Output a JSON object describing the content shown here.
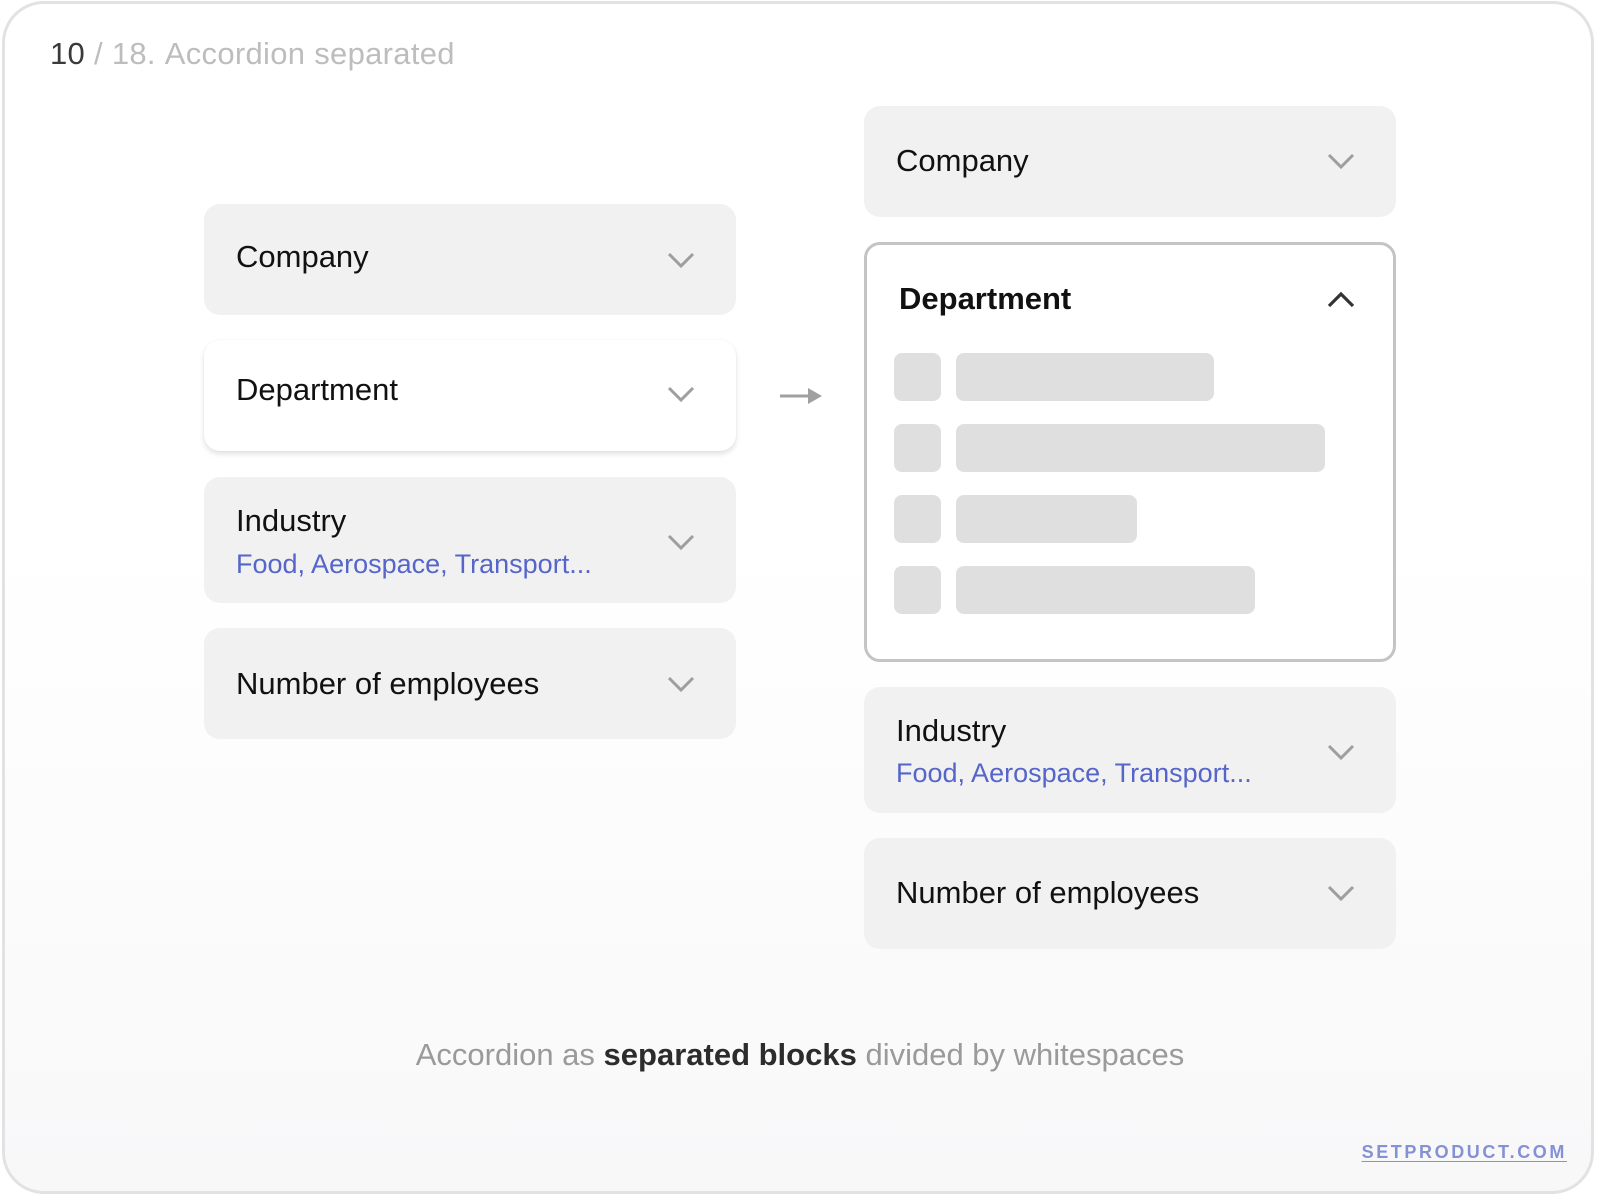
{
  "slide": {
    "number": "10",
    "separator": " / ",
    "total": "18.",
    "title": "Accordion separated"
  },
  "left_accordion": {
    "items": [
      {
        "label": "Company",
        "state": "collapsed",
        "icon": "chevron-down-icon"
      },
      {
        "label": "Department",
        "state": "hover",
        "icon": "chevron-down-icon"
      },
      {
        "label": "Industry",
        "value": "Food, Aerospace, Transport...",
        "state": "collapsed",
        "icon": "chevron-down-icon"
      },
      {
        "label": "Number of employees",
        "state": "collapsed",
        "icon": "chevron-down-icon"
      }
    ]
  },
  "transition_icon": "arrow-right-icon",
  "right_accordion": {
    "items": [
      {
        "label": "Company",
        "state": "collapsed",
        "icon": "chevron-down-icon"
      },
      {
        "label": "Department",
        "state": "expanded",
        "icon": "chevron-up-icon",
        "skeleton_rows": [
          {
            "bar_fill": 0.7
          },
          {
            "bar_fill": 1.0
          },
          {
            "bar_fill": 0.49
          },
          {
            "bar_fill": 0.81
          }
        ]
      },
      {
        "label": "Industry",
        "value": "Food, Aerospace, Transport...",
        "state": "collapsed",
        "icon": "chevron-down-icon"
      },
      {
        "label": "Number of employees",
        "state": "collapsed",
        "icon": "chevron-down-icon"
      }
    ]
  },
  "caption": {
    "part1": "Accordion as ",
    "emphasis": "separated blocks",
    "part2": " divided by whitespaces"
  },
  "brand": "SETPRODUCT.COM",
  "colors": {
    "card_bg": "#f1f1f1",
    "accent_text": "#5565c9",
    "chevron": "#9e9e9e",
    "chevron_active": "#333333",
    "expanded_border": "#c4c4c4",
    "skeleton": "#dfdfdf",
    "brand": "#8491d4"
  }
}
